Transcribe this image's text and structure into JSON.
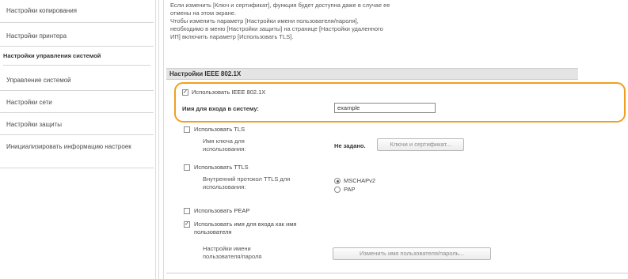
{
  "sidebar": {
    "items": [
      {
        "label": "Настройки копирования"
      },
      {
        "label": "Настройки принтера"
      },
      {
        "label": "Управление системой"
      },
      {
        "label": "Настройки сети"
      },
      {
        "label": "Настройки защиты"
      },
      {
        "label": "Инициализировать информацию настроек"
      }
    ],
    "group_title": "Настройки управления системой"
  },
  "notice": {
    "line1": "Если изменить [Ключ и сертификат], функция будет доступна даже в случае ее",
    "line2": "отмены на этом экране.",
    "line3": "Чтобы изменить параметр [Настройки имени пользователя/пароля],",
    "line4": "необходимо в меню [Настройки защиты] на странице [Настройки удаленного",
    "line5": "ИП] включить параметр [Использовать TLS]."
  },
  "section": {
    "title": "Настройки IEEE 802.1X"
  },
  "form": {
    "use_ieee": {
      "label": "Использовать IEEE 802.1X",
      "checked": true
    },
    "login_name": {
      "label": "Имя для входа в систему:",
      "value": "example"
    },
    "use_tls": {
      "label": "Использовать TLS",
      "checked": false
    },
    "key_name": {
      "label": "Имя ключа для использования:",
      "value": "Не задано.",
      "button": "Ключи и сертификат..."
    },
    "use_ttls": {
      "label": "Использовать TTLS",
      "checked": false
    },
    "ttls_protocol": {
      "label": "Внутренний протокол TTLS для использования:",
      "options": [
        "MSCHAPv2",
        "PAP"
      ],
      "selected": "MSCHAPv2"
    },
    "use_peap": {
      "label": "Использовать PEAP",
      "checked": false
    },
    "use_login_as_user": {
      "label": "Использовать имя для входа как имя пользователя",
      "checked": true
    },
    "user_settings": {
      "label": "Настройки имени пользователя/пароля",
      "button": "Изменить имя пользователя/пароль..."
    }
  },
  "colors": {
    "highlight": "#f0a020",
    "section_bg": "#e4e4e4"
  }
}
